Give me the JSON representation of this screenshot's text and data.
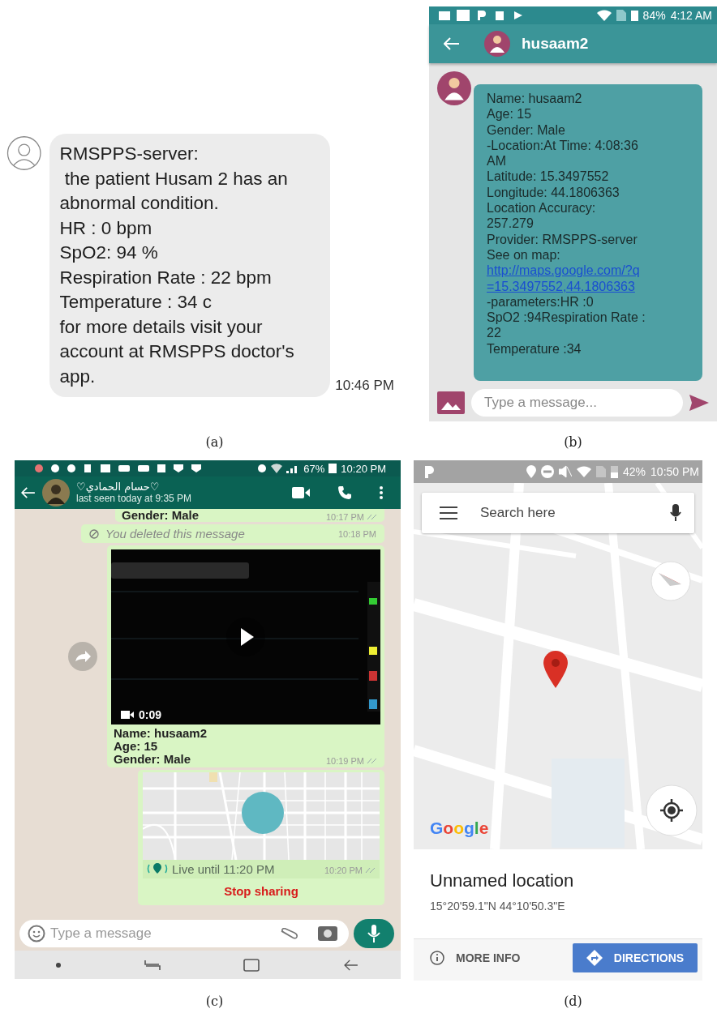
{
  "panel_a": {
    "caption": "(a)",
    "message_lines": [
      "RMSPPS-server:",
      " the patient Husam 2 has an",
      "abnormal condition.",
      "HR : 0 bpm",
      "SpO2: 94 %",
      "Respiration Rate : 22 bpm",
      "Temperature : 34 c",
      "for more details visit your",
      "account at RMSPPS doctor's",
      "app."
    ],
    "time": "10:46 PM"
  },
  "panel_b": {
    "caption": "(b)",
    "status": {
      "battery": "84%",
      "time": "4:12 AM"
    },
    "contact": "husaam2",
    "message_lines": [
      "Name: husaam2",
      "Age: 15",
      "Gender: Male",
      "-Location:At Time: 4:08:36",
      "AM",
      "Latitude: 15.3497552",
      "Longitude: 44.1806363",
      "Location Accuracy:",
      "257.279",
      "Provider: RMSPPS-server",
      "See on map:"
    ],
    "map_link_lines": [
      "http://maps.google.com/?q",
      "=15.3497552,44.1806363"
    ],
    "after_link_lines": [
      "-parameters:HR :0",
      "SpO2 :94Respiration Rate :",
      "22",
      "Temperature :34"
    ],
    "composer": {
      "placeholder": "Type a message..."
    }
  },
  "panel_c": {
    "caption": "(c)",
    "status": {
      "battery": "67%",
      "time": "10:20 PM"
    },
    "contact": {
      "name": "♡حسام الحمادي♡",
      "last_seen": "last seen today at 9:35 PM"
    },
    "messages": [
      {
        "kind": "text",
        "lines": [
          "Gender: Male"
        ],
        "time": "10:17 PM"
      },
      {
        "kind": "deleted",
        "text": "You deleted this message",
        "time": "10:18 PM"
      },
      {
        "kind": "video",
        "duration": "0:09",
        "lines": [
          "Name: husaam2",
          "Age: 15",
          "Gender: Male"
        ],
        "time": "10:19 PM"
      },
      {
        "kind": "live_location",
        "text": "Live until 11:20 PM",
        "time": "10:20 PM",
        "action": "Stop sharing"
      }
    ],
    "composer": {
      "placeholder": "Type a message"
    }
  },
  "panel_d": {
    "caption": "(d)",
    "status": {
      "battery": "42%",
      "time": "10:50 PM"
    },
    "search": {
      "placeholder": "Search here"
    },
    "logo": "Google",
    "place": {
      "title": "Unnamed location",
      "coordinates": "15°20'59.1\"N 44°10'50.3\"E"
    },
    "actions": [
      "MORE INFO",
      "DIRECTIONS"
    ]
  }
}
